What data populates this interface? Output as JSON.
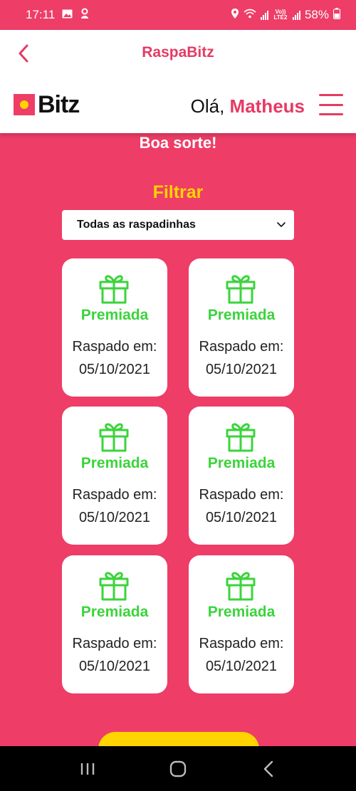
{
  "status_bar": {
    "time": "17:11",
    "battery": "58%",
    "volte": "Vo)) LTE2"
  },
  "header": {
    "title": "RaspaBitz",
    "logo_text": "Bitz",
    "greeting": "Olá,",
    "user_name": "Matheus"
  },
  "main": {
    "luck_message": "Boa sorte!",
    "filter_title": "Filtrar",
    "filter_select": {
      "selected": "Todas as raspadinhas"
    },
    "cards": [
      {
        "status": "Premiada",
        "label": "Raspado em:",
        "date": "05/10/2021"
      },
      {
        "status": "Premiada",
        "label": "Raspado em:",
        "date": "05/10/2021"
      },
      {
        "status": "Premiada",
        "label": "Raspado em:",
        "date": "05/10/2021"
      },
      {
        "status": "Premiada",
        "label": "Raspado em:",
        "date": "05/10/2021"
      },
      {
        "status": "Premiada",
        "label": "Raspado em:",
        "date": "05/10/2021"
      },
      {
        "status": "Premiada",
        "label": "Raspado em:",
        "date": "05/10/2021"
      }
    ]
  },
  "colors": {
    "background": "#ee3d67",
    "accent_pink": "#e53b63",
    "accent_yellow": "#ffd400",
    "prize_green": "#3bd43b"
  },
  "icons": {
    "back": "chevron-left-icon",
    "menu": "hamburger-menu-icon",
    "card": "gift-icon",
    "select": "chevron-down-icon"
  }
}
